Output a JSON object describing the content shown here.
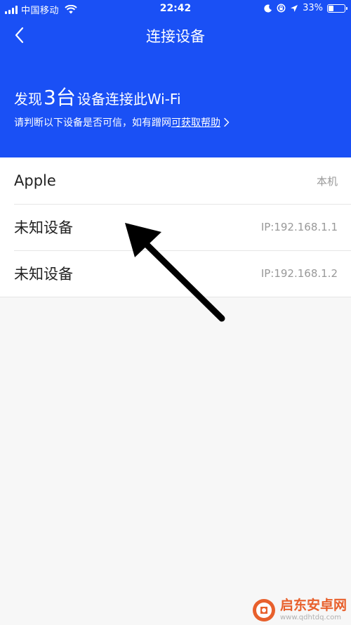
{
  "status_bar": {
    "carrier": "中国移动",
    "time": "22:42",
    "battery_percent": "33%",
    "battery_level": 0.33,
    "icons": [
      "signal-icon",
      "wifi-icon",
      "moon-icon",
      "rotation-lock-icon",
      "location-icon",
      "battery-icon"
    ]
  },
  "nav": {
    "title": "连接设备",
    "back_icon": "chevron-left-icon"
  },
  "summary": {
    "prefix": "发现",
    "count": "3台",
    "suffix": "设备连接此Wi-Fi",
    "hint": "请判断以下设备是否可信，如有蹭网",
    "help_link": "可获取帮助"
  },
  "devices": [
    {
      "name": "Apple",
      "detail": "本机"
    },
    {
      "name": "未知设备",
      "detail": "IP:192.168.1.1"
    },
    {
      "name": "未知设备",
      "detail": "IP:192.168.1.2"
    }
  ],
  "watermark": {
    "name": "启东安卓网",
    "url": "www.qdhtdq.com"
  },
  "colors": {
    "header_bg": "#1a50f5",
    "page_bg": "#f7f7f7",
    "annotation_arrow": "#000000",
    "watermark_accent": "#e8602c"
  }
}
